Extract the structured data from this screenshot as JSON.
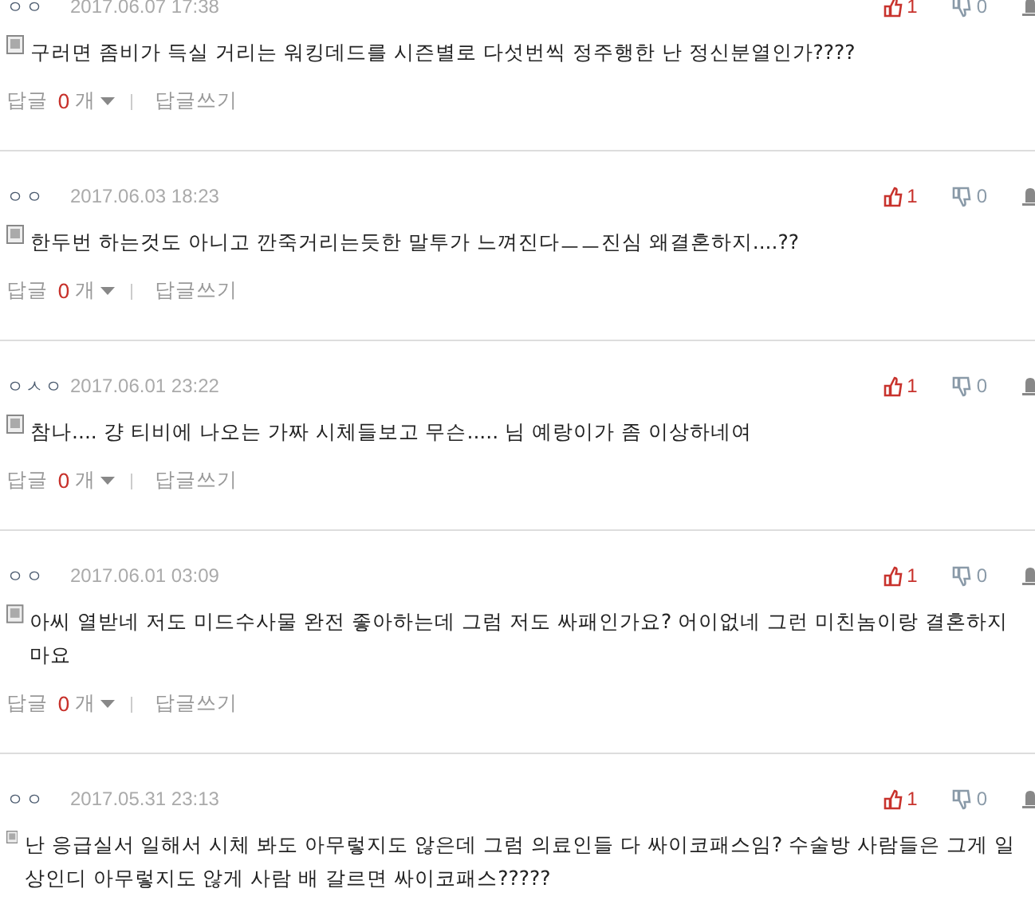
{
  "comments": [
    {
      "author": "ㅇㅇ",
      "date": "2017.06.07 17:38",
      "likes": "1",
      "dislikes": "0",
      "body": "구러면 좀비가 득실 거리는 워킹데드를 시즌별로 다섯번씩 정주행한 난 정신분열인가????",
      "reply": {
        "label": "답글",
        "count": "0",
        "unit": "개",
        "write": "답글쓰기"
      }
    },
    {
      "author": "ㅇㅇ",
      "date": "2017.06.03 18:23",
      "likes": "1",
      "dislikes": "0",
      "body": "한두번 하는것도 아니고 깐죽거리는듯한 말투가 느껴진다ㅡㅡ진심 왜결혼하지....??",
      "reply": {
        "label": "답글",
        "count": "0",
        "unit": "개",
        "write": "답글쓰기"
      }
    },
    {
      "author": "ㅇㅅㅇ",
      "date": "2017.06.01 23:22",
      "likes": "1",
      "dislikes": "0",
      "body": "참나.... 걍 티비에 나오는 가짜 시체들보고 무슨..... 님 예랑이가 좀 이상하네여",
      "reply": {
        "label": "답글",
        "count": "0",
        "unit": "개",
        "write": "답글쓰기"
      }
    },
    {
      "author": "ㅇㅇ",
      "date": "2017.06.01 03:09",
      "likes": "1",
      "dislikes": "0",
      "body": "아씨 열받네 저도 미드수사물 완전 좋아하는데 그럼 저도 싸패인가요? 어이없네 그런 미친놈이랑 결혼하지 마요",
      "reply": {
        "label": "답글",
        "count": "0",
        "unit": "개",
        "write": "답글쓰기"
      }
    },
    {
      "author": "ㅇㅇ",
      "date": "2017.05.31 23:13",
      "likes": "1",
      "dislikes": "0",
      "body": "난 응급실서 일해서 시체 봐도 아무렇지도 않은데 그럼 의료인들 다 싸이코패스임? 수술방 사람들은 그게 일상인디 아무렇지도 않게 사람 배 갈르면 싸이코패스?????"
    }
  ]
}
